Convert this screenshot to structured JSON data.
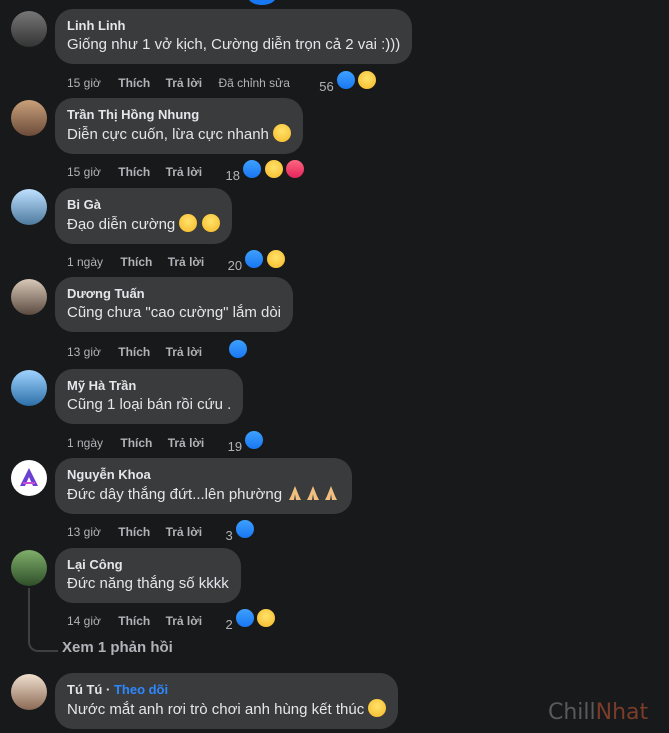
{
  "comments": [
    {
      "name": "Linh Linh",
      "text": "Giống như 1 vở kịch, Cường diễn trọn cả 2 vai :)))",
      "time": "15 giờ",
      "like": "Thích",
      "reply": "Trả lời",
      "edited": "Đã chỉnh sửa",
      "count": "56"
    },
    {
      "name": "Trần Thị Hồng Nhung",
      "text": "Diễn cực cuốn, lừa cực nhanh",
      "time": "15 giờ",
      "like": "Thích",
      "reply": "Trả lời",
      "count": "18"
    },
    {
      "name": "Bi Gà",
      "text": "Đạo diễn cường",
      "time": "1 ngày",
      "like": "Thích",
      "reply": "Trả lời",
      "count": "20"
    },
    {
      "name": "Dương Tuấn",
      "text": "Cũng chưa \"cao cường\" lắm dòi",
      "time": "13 giờ",
      "like": "Thích",
      "reply": "Trả lời",
      "count": ""
    },
    {
      "name": "Mỹ Hà Trần",
      "text": "Cũng 1 loại bán rồi cứu .",
      "time": "1 ngày",
      "like": "Thích",
      "reply": "Trả lời",
      "count": "19"
    },
    {
      "name": "Nguyễn Khoa",
      "text": "Đức dây thắng đứt...lên phường",
      "time": "13 giờ",
      "like": "Thích",
      "reply": "Trả lời",
      "count": "3"
    },
    {
      "name": "Lại Công",
      "text": "Đức năng thắng số kkkk",
      "time": "14 giờ",
      "like": "Thích",
      "reply": "Trả lời",
      "count": "2"
    },
    {
      "name": "Tú Tú",
      "text": "Nước mắt anh rơi trò chơi anh hùng kết thúc",
      "follow": "Theo dõi"
    }
  ],
  "view_replies": "Xem 1 phản hồi",
  "watermark_a": "Chill",
  "watermark_b": "Nhat",
  "icons": {
    "like": "like-reaction-icon",
    "haha": "haha-reaction-icon",
    "love": "love-reaction-icon"
  }
}
